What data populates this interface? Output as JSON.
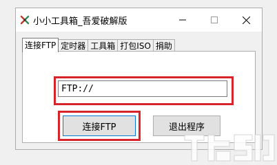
{
  "window": {
    "title": "小小工具箱_吾爱破解版",
    "icon": "app-icon",
    "controls": {
      "minimize": "—",
      "maximize": "☐",
      "close": "✕"
    }
  },
  "tabs": [
    {
      "label": "连接FTP",
      "active": true
    },
    {
      "label": "定时器",
      "active": false
    },
    {
      "label": "工具箱",
      "active": false
    },
    {
      "label": "打包ISO",
      "active": false
    },
    {
      "label": "捐助",
      "active": false
    }
  ],
  "ftp_panel": {
    "address_value": "FTP://",
    "connect_label": "连接FTP",
    "exit_label": "退出程序"
  },
  "colors": {
    "highlight": "#d9232b",
    "focus_border": "#0078d7",
    "window_bg": "#f0f0f0"
  }
}
